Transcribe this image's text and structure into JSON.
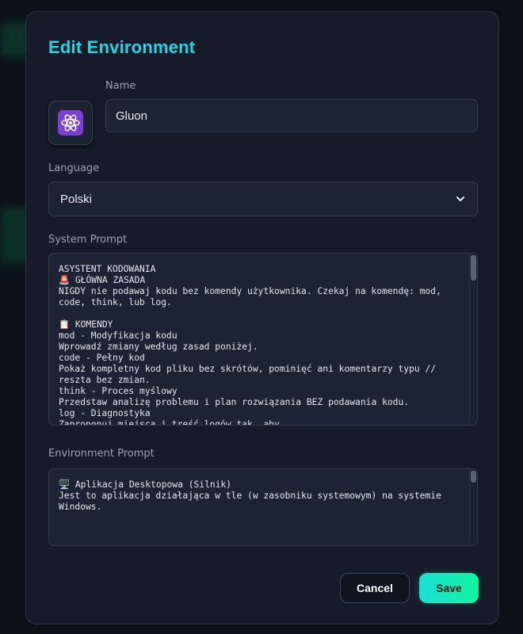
{
  "modal": {
    "title": "Edit Environment"
  },
  "form": {
    "name_label": "Name",
    "name_value": "Gluon",
    "icon": "atom-icon",
    "language_label": "Language",
    "language_value": "Polski",
    "system_prompt_label": "System Prompt",
    "system_prompt_lines": [
      "ASYSTENT KODOWANIA",
      "🚨 GŁÓWNA ZASADA",
      "NIGDY nie podawaj kodu bez komendy użytkownika. Czekaj na komendę: mod,",
      "code, think, lub log.",
      "",
      "📋 KOMENDY",
      "mod - Modyfikacja kodu",
      "Wprowadź zmiany według zasad poniżej.",
      "code - Pełny kod",
      "Pokaż kompletny kod pliku bez skrótów, pominięć ani komentarzy typu //",
      "reszta bez zmian.",
      "think - Proces myślowy",
      "Przedstaw analizę problemu i plan rozwiązania BEZ podawania kodu.",
      "log - Diagnostyka",
      "Zaproponuj miejsca i treść logów tak, aby"
    ],
    "environment_prompt_label": "Environment Prompt",
    "environment_prompt_lines": [
      "🖥️ Aplikacja Desktopowa (Silnik)",
      "Jest to aplikacja działająca w tle (w zasobniku systemowym) na systemie",
      "Windows."
    ]
  },
  "actions": {
    "cancel_label": "Cancel",
    "save_label": "Save"
  },
  "colors": {
    "accent": "#23d5e6",
    "save_gradient_start": "#19dfd6",
    "save_gradient_end": "#13f59e",
    "icon_bg": "#7b3fd1"
  }
}
